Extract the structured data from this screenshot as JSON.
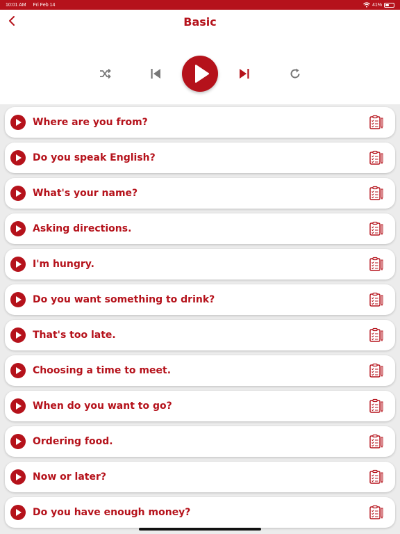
{
  "status_bar": {
    "time": "10:01 AM",
    "date": "Fri Feb 14",
    "battery": "41%",
    "battery_level": 0.41,
    "icons": [
      "wifi-icon",
      "battery-icon"
    ]
  },
  "header": {
    "title": "Basic",
    "back_icon": "chevron-left-icon"
  },
  "player": {
    "controls": [
      "shuffle-icon",
      "skip-previous-icon",
      "play-icon",
      "skip-next-icon",
      "repeat-icon"
    ]
  },
  "colors": {
    "accent": "#b5121b",
    "background": "#ececec",
    "card": "#ffffff"
  },
  "phrases": [
    {
      "label": "Where are you from?"
    },
    {
      "label": "Do you speak English?"
    },
    {
      "label": "What's your name?"
    },
    {
      "label": "Asking directions."
    },
    {
      "label": "I'm hungry."
    },
    {
      "label": "Do you want something to drink?"
    },
    {
      "label": "That's too late."
    },
    {
      "label": "Choosing a time to meet."
    },
    {
      "label": "When do you want to go?"
    },
    {
      "label": "Ordering food."
    },
    {
      "label": "Now or later?"
    },
    {
      "label": "Do you have enough money?"
    }
  ],
  "row_icons": {
    "play": "play-circle-icon",
    "detail": "clipboard-icon"
  }
}
